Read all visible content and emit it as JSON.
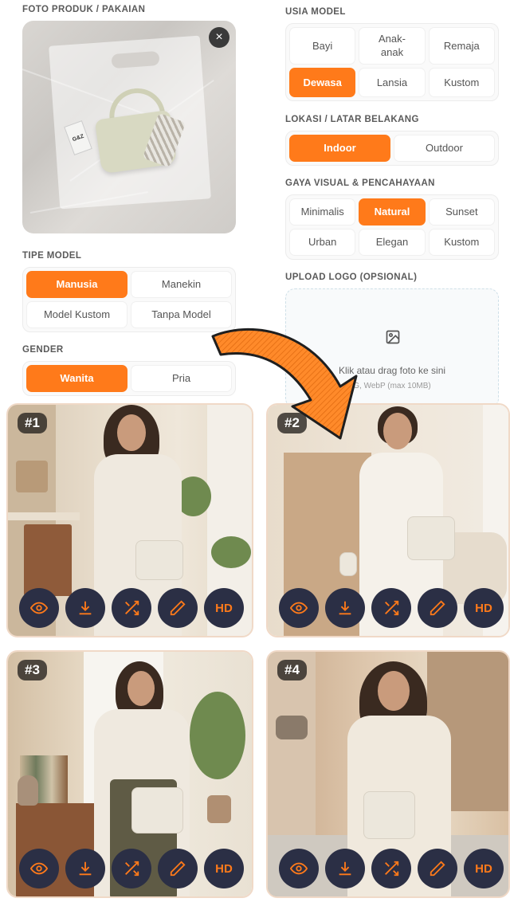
{
  "left": {
    "product_label": "FOTO PRODUK / PAKAIAN",
    "price_tag_text": "G&Z",
    "remove_symbol": "×",
    "model_type_label": "TIPE MODEL",
    "model_types": [
      "Manusia",
      "Manekin",
      "Model Kustom",
      "Tanpa Model"
    ],
    "gender_label": "GENDER",
    "genders": [
      "Wanita",
      "Pria"
    ]
  },
  "right": {
    "age_label": "USIA MODEL",
    "ages": [
      "Bayi",
      "Anak-\nanak",
      "Remaja",
      "Dewasa",
      "Lansia",
      "Kustom"
    ],
    "location_label": "LOKASI / LATAR BELAKANG",
    "locations": [
      "Indoor",
      "Outdoor"
    ],
    "style_label": "GAYA VISUAL & PENCAHAYAAN",
    "styles": [
      "Minimalis",
      "Natural",
      "Sunset",
      "Urban",
      "Elegan",
      "Kustom"
    ],
    "upload_label": "UPLOAD LOGO (OPSIONAL)",
    "upload_text": "Klik atau drag foto ke sini",
    "upload_sub": "G, WebP (max 10MB)"
  },
  "results": [
    {
      "badge": "#1",
      "hd": "HD"
    },
    {
      "badge": "#2",
      "hd": "HD"
    },
    {
      "badge": "#3",
      "hd": "HD"
    },
    {
      "badge": "#4",
      "hd": "HD"
    }
  ],
  "colors": {
    "accent": "#ff7a1a",
    "action_bg": "#2b2f45"
  },
  "icons": [
    "close-icon",
    "image-icon",
    "eye-icon",
    "download-icon",
    "shuffle-icon",
    "pencil-icon",
    "arrow-icon"
  ]
}
